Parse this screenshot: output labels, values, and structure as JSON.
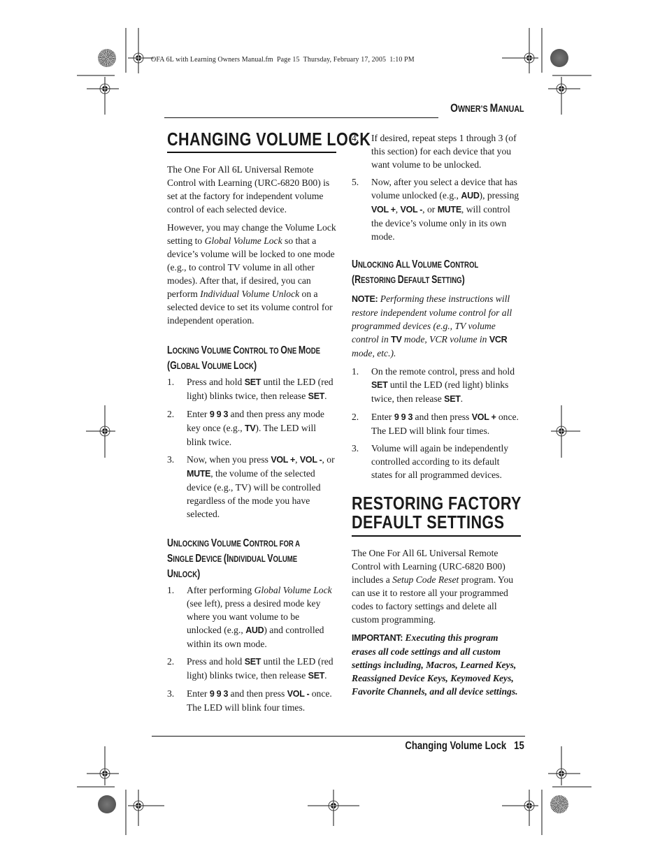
{
  "fm_header": "OFA 6L with Learning Owners Manual.fm  Page 15  Thursday, February 17, 2005  1:10 PM",
  "running_head": {
    "first_o": "O",
    "rest1": "WNER’S ",
    "first_m": "M",
    "rest2": "ANUAL"
  },
  "left": {
    "title": "CHANGING VOLUME LOCK",
    "para1": "The One For All 6L Universal Remote Control with Learning (URC-6820 B00) is set at the factory for independent volume control of each selected device.",
    "para2": {
      "a": "However, you may change the Volume Lock setting to ",
      "i1": "Global Volume Lock",
      "b": " so that a device’s volume will be locked to one mode (e.g., to control TV volume in all other modes). After that, if desired, you can perform ",
      "i2": "Individual Volume Unlock",
      "c": " on a selected device to set its volume control for independent operation."
    },
    "section1": {
      "heading_line1": "Locking Volume Control to One Mode",
      "heading_line2": "(Global Volume Lock)",
      "steps": [
        {
          "num": "1.",
          "a": "Press and hold ",
          "k1": "SET",
          "b": " until the LED (red light) blinks twice, then release ",
          "k2": "SET",
          "c": "."
        },
        {
          "num": "2.",
          "a": "Enter ",
          "k1": "9 9 3",
          "b": " and then press any mode key once (e.g., ",
          "k2": "TV",
          "c": "). The LED will blink twice."
        },
        {
          "num": "3.",
          "a": "Now, when you press ",
          "k1": "VOL +",
          "b": ", ",
          "k2": "VOL -",
          "c": ", or ",
          "k3": "MUTE",
          "d": ", the volume of the selected device (e.g., TV) will be controlled regardless of the mode you have selected."
        }
      ]
    },
    "section2": {
      "heading_line1": "Unlocking Volume Control for a",
      "heading_line2": "Single Device (Individual Volume",
      "heading_line3": "Unlock)",
      "steps": [
        {
          "num": "1.",
          "a": "After performing ",
          "i1": "Global Volume Lock",
          "b": " (see left), press a desired mode key where you want volume to be unlocked (e.g., ",
          "k1": "AUD",
          "c": ") and controlled within its own mode."
        },
        {
          "num": "2.",
          "a": "Press and hold ",
          "k1": "SET",
          "b": " until the LED (red light) blinks twice, then release ",
          "k2": "SET",
          "c": "."
        },
        {
          "num": "3.",
          "a": "Enter ",
          "k1": "9 9 3",
          "b": " and then press ",
          "k2": "VOL -",
          "c": " once. The LED will blink four times."
        }
      ]
    }
  },
  "right": {
    "steps_cont": [
      {
        "num": "4.",
        "a": "If desired, repeat steps 1 through 3 (of this section) for each device that you want volume to be unlocked."
      },
      {
        "num": "5.",
        "a": "Now, after you select a device that has volume unlocked (e.g., ",
        "k1": "AUD",
        "b": "), pressing ",
        "k2": "VOL +",
        "c": ", ",
        "k3": "VOL -",
        "d": ", or ",
        "k4": "MUTE",
        "e": ", will control the device’s volume only in its own mode."
      }
    ],
    "section3": {
      "heading_line1": "Unlocking All Volume Control",
      "heading_line2": "(Restoring Default Setting)",
      "note": {
        "label": "NOTE:",
        "a": " Performing these instructions will restore independent volume control for all programmed devices (e.g., TV volume control in ",
        "k1": "TV",
        "b": " mode, VCR volume in ",
        "k2": "VCR",
        "c": " mode, etc.)."
      },
      "steps": [
        {
          "num": "1.",
          "a": "On the remote control, press and hold ",
          "k1": "SET",
          "b": " until the LED (red light) blinks twice, then release ",
          "k2": "SET",
          "c": "."
        },
        {
          "num": "2.",
          "a": "Enter ",
          "k1": "9 9 3",
          "b": " and then press ",
          "k2": "VOL +",
          "c": " once. The LED will blink four times."
        },
        {
          "num": "3.",
          "a": "Volume will again be independently controlled according to its default states for all programmed devices."
        }
      ]
    },
    "title2_line1": "RESTORING FACTORY",
    "title2_line2": "DEFAULT SETTINGS",
    "para3": {
      "a": "The One For All 6L Universal Remote Control with Learning (URC-6820 B00) includes a ",
      "i1": "Setup Code Reset",
      "b": " program. You can use it to restore all your programmed codes to factory settings and delete all custom programming."
    },
    "important": {
      "label": "IMPORTANT:",
      "text": " Executing this program erases all code settings and all custom settings including, Macros, Learned Keys, Reassigned Device Keys, Keymoved Keys, Favorite Channels, and all device settings."
    }
  },
  "footer": {
    "section": "Changing Volume Lock",
    "page": "15"
  }
}
